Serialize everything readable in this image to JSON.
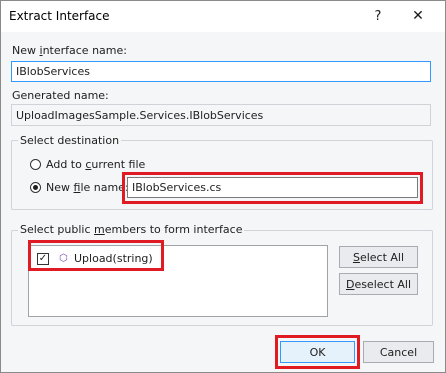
{
  "window": {
    "title": "Extract Interface",
    "help_glyph": "?",
    "close_glyph": "✕"
  },
  "interface_name": {
    "label": "New interface name:",
    "value": "IBlobServices"
  },
  "generated_name": {
    "label": "Generated name:",
    "value": "UploadImagesSample.Services.IBlobServices"
  },
  "destination": {
    "group_title": "Select destination",
    "add_to_current_label": "Add to current file",
    "new_file_label": "New file name:",
    "new_file_value": "IBlobServices.cs",
    "selected": "new_file"
  },
  "members": {
    "group_title": "Select public members to form interface",
    "items": [
      {
        "label": "Upload(string)",
        "checked": true,
        "icon": "method-cube-icon"
      }
    ],
    "select_all_label": "Select All",
    "deselect_all_label": "Deselect All"
  },
  "footer": {
    "ok_label": "OK",
    "cancel_label": "Cancel"
  },
  "colors": {
    "highlight": "#e01b24",
    "focus_border": "#3399ff",
    "method_icon": "#7b46b0"
  }
}
